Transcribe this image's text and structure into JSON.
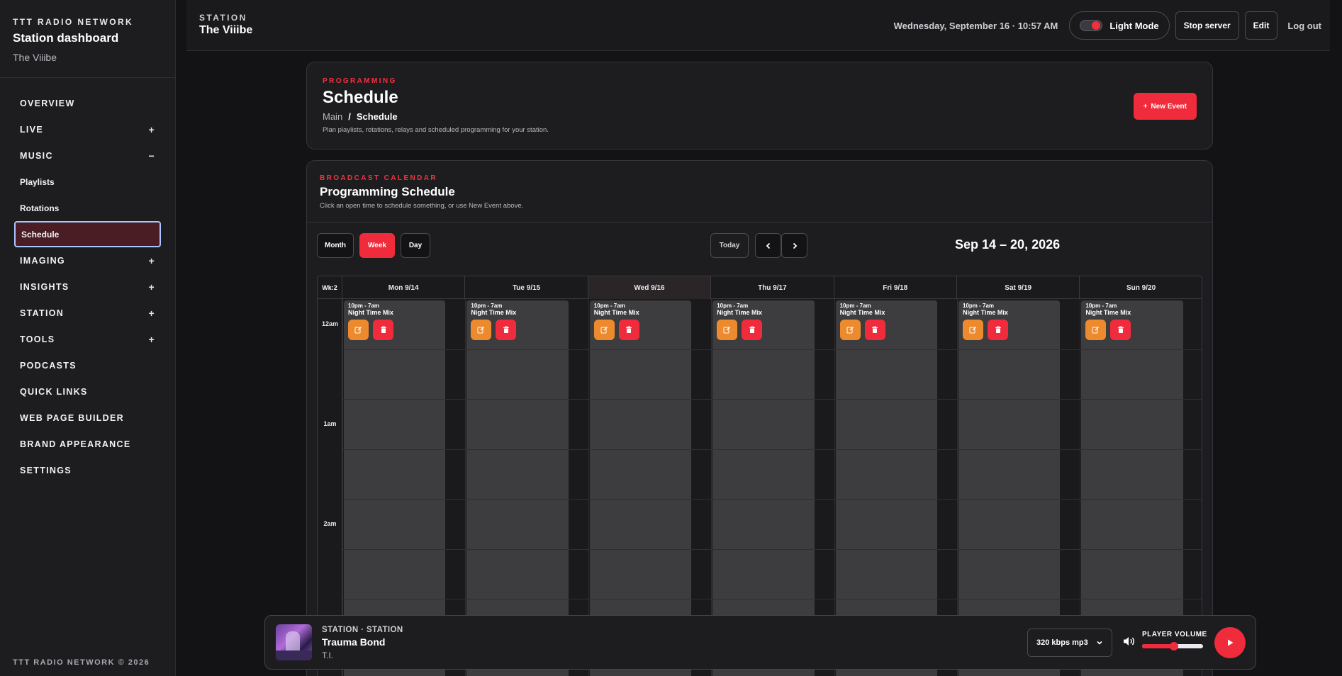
{
  "sidebar": {
    "network": "TTT RADIO NETWORK",
    "title": "Station dashboard",
    "station": "The Viiibe",
    "items": [
      {
        "label": "OVERVIEW",
        "toggle": "",
        "sub": false,
        "active": false
      },
      {
        "label": "LIVE",
        "toggle": "+",
        "sub": false,
        "active": false
      },
      {
        "label": "MUSIC",
        "toggle": "−",
        "sub": false,
        "active": false
      },
      {
        "label": "Playlists",
        "toggle": "",
        "sub": true,
        "active": false
      },
      {
        "label": "Rotations",
        "toggle": "",
        "sub": true,
        "active": false
      },
      {
        "label": "Schedule",
        "toggle": "",
        "sub": true,
        "active": true
      },
      {
        "label": "IMAGING",
        "toggle": "+",
        "sub": false,
        "active": false
      },
      {
        "label": "INSIGHTS",
        "toggle": "+",
        "sub": false,
        "active": false
      },
      {
        "label": "STATION",
        "toggle": "+",
        "sub": false,
        "active": false
      },
      {
        "label": "TOOLS",
        "toggle": "+",
        "sub": false,
        "active": false
      },
      {
        "label": "PODCASTS",
        "toggle": "",
        "sub": false,
        "active": false
      },
      {
        "label": "QUICK LINKS",
        "toggle": "",
        "sub": false,
        "active": false
      },
      {
        "label": "WEB PAGE BUILDER",
        "toggle": "",
        "sub": false,
        "active": false
      },
      {
        "label": "BRAND APPEARANCE",
        "toggle": "",
        "sub": false,
        "active": false
      },
      {
        "label": "SETTINGS",
        "toggle": "",
        "sub": false,
        "active": false
      }
    ],
    "copyright": "TTT RADIO NETWORK © 2026"
  },
  "header": {
    "label": "STATION",
    "station": "The Viiibe",
    "datetime": "Wednesday, September 16 · 10:57 AM",
    "light_mode": "Light Mode",
    "stop_server": "Stop server",
    "edit": "Edit",
    "logout": "Log out"
  },
  "schedule_card": {
    "eyebrow": "PROGRAMMING",
    "title": "Schedule",
    "breadcrumb_root": "Main",
    "breadcrumb_sep": "/",
    "breadcrumb_current": "Schedule",
    "description": "Plan playlists, rotations, relays and scheduled programming for your station.",
    "new_event": "New Event",
    "new_event_icon": "plus-icon"
  },
  "calendar_card": {
    "eyebrow": "BROADCAST CALENDAR",
    "title": "Programming Schedule",
    "description": "Click an open time to schedule something, or use New Event above.",
    "views": [
      "Month",
      "Week",
      "Day"
    ],
    "active_view": "Week",
    "today": "Today",
    "range": "Sep 14 – 20, 2026",
    "week_label": "Wk:2",
    "days": [
      "Mon 9/14",
      "Tue 9/15",
      "Wed 9/16",
      "Thu 9/17",
      "Fri 9/18",
      "Sat 9/19",
      "Sun 9/20"
    ],
    "today_index": 2,
    "hours": [
      "12am",
      "1am",
      "2am"
    ],
    "event": {
      "time": "10pm - 7am",
      "title": "Night Time Mix"
    }
  },
  "player": {
    "meta": "STATION · STATION",
    "title": "Trauma Bond",
    "artist": "T.I.",
    "quality": "320 kbps mp3",
    "volume_label": "PLAYER VOLUME",
    "volume": 0.52
  },
  "colors": {
    "accent": "#f02b3b",
    "edit": "#ee8a2e"
  }
}
